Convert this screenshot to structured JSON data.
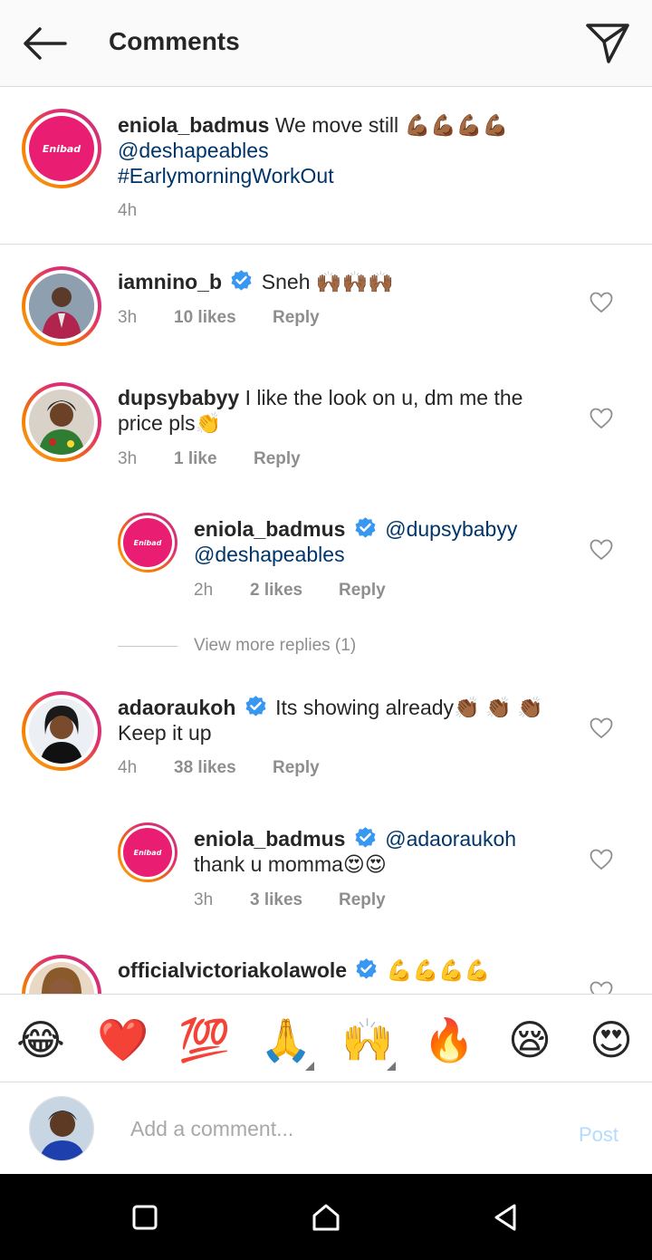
{
  "header": {
    "title": "Comments"
  },
  "caption": {
    "username": "eniola_badmus",
    "text": "We move still",
    "emoji": "💪🏾💪🏾💪🏾💪🏾",
    "mention": "@deshapeables",
    "hashtag": "#EarlymorningWorkOut",
    "time": "4h",
    "logo_text": "Enibad"
  },
  "comments": [
    {
      "username": "iamnino_b",
      "text": "Sneh",
      "emoji": "🙌🏾🙌🏾🙌🏾",
      "time": "3h",
      "likes": "10 likes",
      "reply": "Reply"
    },
    {
      "username": "dupsybabyy",
      "text": "I like the look on u, dm me the",
      "text2": "price pls",
      "emoji": "👏",
      "time": "3h",
      "likes": "1 like",
      "reply": "Reply"
    },
    {
      "username": "eniola_badmus",
      "mention": "@dupsybabyy",
      "mention2": "@deshapeables",
      "time": "2h",
      "likes": "2 likes",
      "reply": "Reply",
      "logo_text": "Enibad"
    },
    {
      "username": "adaoraukoh",
      "text": "Its showing already",
      "emoji": "👏🏾 👏🏾 👏🏾",
      "text2": "Keep it up",
      "time": "4h",
      "likes": "38 likes",
      "reply": "Reply"
    },
    {
      "username": "eniola_badmus",
      "mention": "@adaoraukoh",
      "text2": "thank u momma",
      "emoji": "😍😍",
      "time": "3h",
      "likes": "3 likes",
      "reply": "Reply",
      "logo_text": "Enibad"
    },
    {
      "username": "officialvictoriakolawole",
      "emoji": "💪💪💪💪"
    }
  ],
  "view_more": "View more replies (1)",
  "emoji_bar": [
    "😂",
    "❤️",
    "💯",
    "🙏",
    "🙌",
    "🔥",
    "😪",
    "😍"
  ],
  "input": {
    "placeholder": "Add a comment...",
    "post_label": "Post"
  },
  "colors": {
    "accent": "#0095f6",
    "mention": "#003569",
    "brand_pink": "#e91e72",
    "verified": "#3897f0"
  }
}
